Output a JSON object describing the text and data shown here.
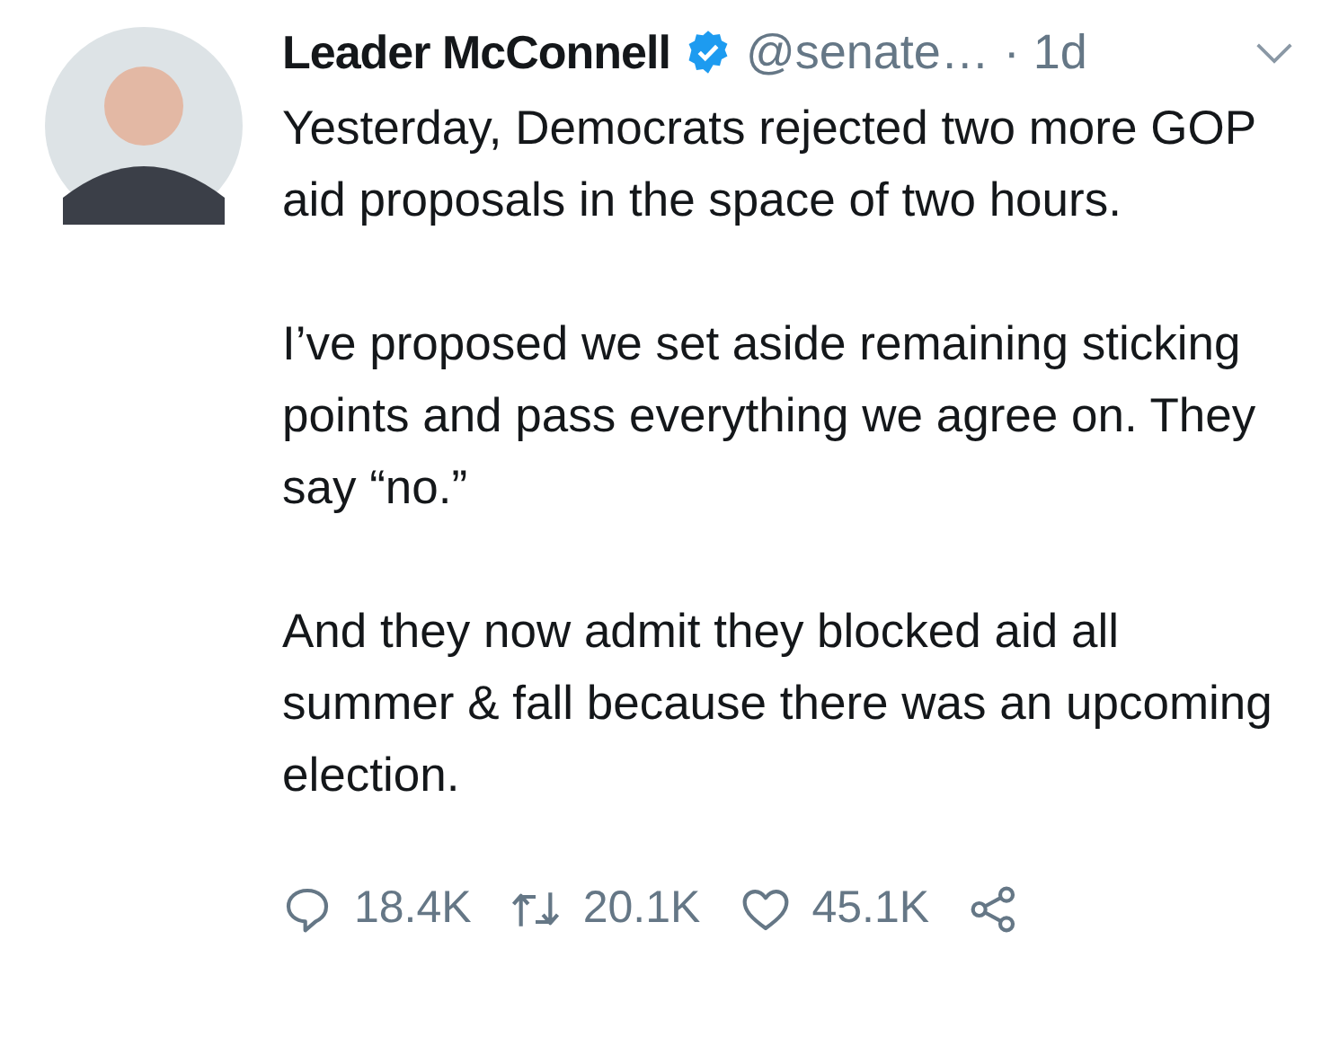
{
  "tweet": {
    "author": {
      "name": "Leader McConnell",
      "verified": true,
      "handle": "@senate…",
      "time": "· 1d"
    },
    "paragraphs": [
      "Yesterday, Democrats rejected two more GOP aid proposals in the space of two hours.",
      "I’ve proposed we set aside remaining sticking points and pass everything we agree on. They say “no.”",
      "And they now admit they blocked aid all summer & fall because there was an upcoming election."
    ],
    "actions": [
      {
        "kind": "reply",
        "count": "18.4K"
      },
      {
        "kind": "retweet",
        "count": "20.1K"
      },
      {
        "kind": "like",
        "count": "45.1K"
      },
      {
        "kind": "share"
      }
    ]
  }
}
